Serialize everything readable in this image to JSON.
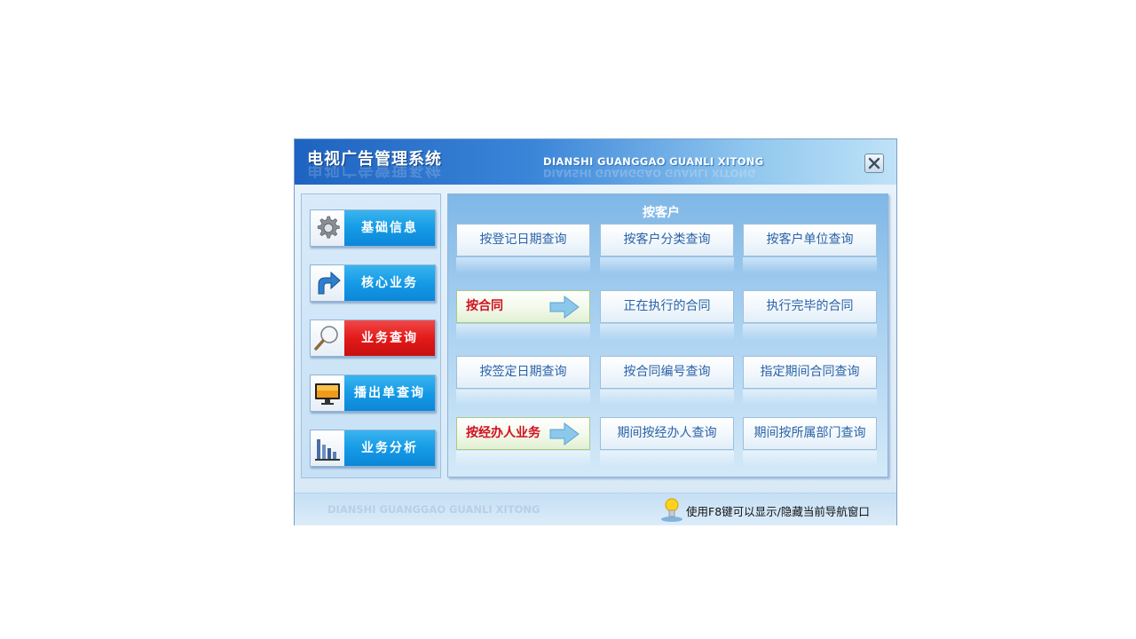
{
  "window": {
    "title": "电视广告管理系统",
    "title_pinyin": "DIANSHI GUANGGAO GUANLI XITONG",
    "close_label": "×"
  },
  "sidebar": {
    "items": [
      {
        "label": "基础信息",
        "icon": "gear-icon",
        "active": false
      },
      {
        "label": "核心业务",
        "icon": "arrow-turn-icon",
        "active": false
      },
      {
        "label": "业务查询",
        "icon": "magnifier-icon",
        "active": true
      },
      {
        "label": "播出单查询",
        "icon": "monitor-icon",
        "active": false
      },
      {
        "label": "业务分析",
        "icon": "bar-chart-icon",
        "active": false
      }
    ]
  },
  "panel": {
    "heading": "按客户",
    "rows": [
      {
        "items": [
          "按登记日期查询",
          "按客户分类查询",
          "按客户单位查询"
        ]
      },
      {
        "category": "按合同",
        "items": [
          "正在执行的合同",
          "执行完毕的合同"
        ]
      },
      {
        "items": [
          "按签定日期查询",
          "按合同编号查询",
          "指定期间合同查询"
        ]
      },
      {
        "category": "按经办人业务",
        "items": [
          "期间按经办人查询",
          "期间按所属部门查询"
        ]
      }
    ]
  },
  "footer": {
    "pinyin": "DIANSHI GUANGGAO GUANLI XITONG",
    "hint": "使用F8键可以显示/隐藏当前导航窗口"
  },
  "colors": {
    "accent_blue": "#159be6",
    "active_red": "#e31a1a",
    "category_red": "#d1101e",
    "link_blue": "#2a63a8"
  }
}
